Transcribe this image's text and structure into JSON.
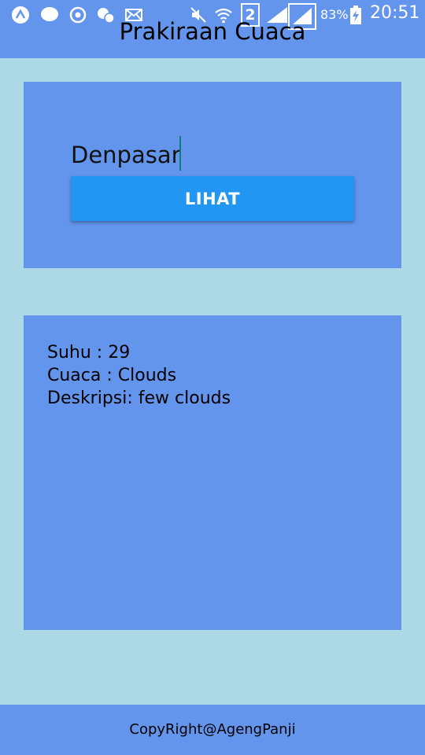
{
  "status_bar": {
    "icons": [
      "nav-icon",
      "line-icon",
      "sync-icon",
      "chat-notify-icon",
      "mail-icon",
      "mute-icon",
      "wifi-icon",
      "sim2-icon",
      "signal-icon",
      "signal-icon-2",
      "battery-charging-icon"
    ],
    "sim_label": "2",
    "battery": "83%",
    "time": "20:51"
  },
  "app": {
    "title": "Prakiraan Cuaca"
  },
  "search": {
    "city_value": "Denpasar",
    "button_label": "LIHAT"
  },
  "result": {
    "suhu": "Suhu :  29",
    "cuaca": "Cuaca :  Clouds",
    "deskripsi": "Deskripsi: few clouds"
  },
  "footer": {
    "text": "CopyRight@AgengPanji"
  },
  "colors": {
    "background": "#add8e6",
    "panel": "#6495ed",
    "button": "#2196f3",
    "caret": "#0f7c80"
  }
}
